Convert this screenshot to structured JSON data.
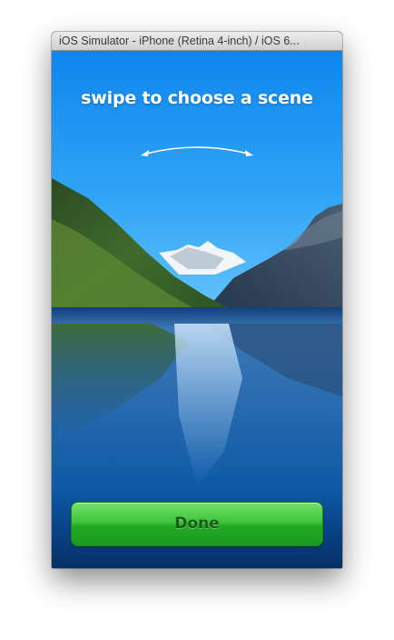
{
  "window": {
    "title": "iOS Simulator - iPhone (Retina 4-inch) / iOS 6..."
  },
  "screen": {
    "instruction": "swipe to choose a scene",
    "swipe_icon": "double-headed-curved-arrow",
    "scene_image": "mountain-lake-landscape"
  },
  "actions": {
    "done_label": "Done"
  },
  "colors": {
    "sky": "#1a8ff0",
    "water": "#0b5aa8",
    "done_button": "#3cc33a",
    "done_text": "#1d5b1c"
  }
}
